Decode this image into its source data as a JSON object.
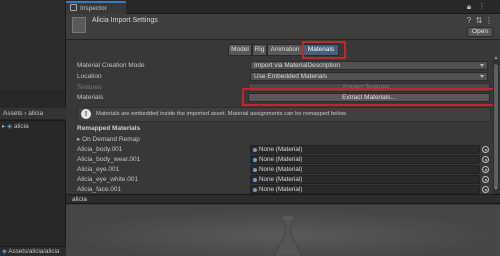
{
  "inspector": {
    "tab_label": "Inspector",
    "icons": [
      "lock-icon",
      "kebab-menu-icon"
    ],
    "asset_title": "Alicia Import Settings",
    "open_label": "Open"
  },
  "toolbar": {
    "tabs": [
      "Model",
      "Rig",
      "Animation",
      "Materials"
    ],
    "selected": "Materials",
    "selected_color": "#46607c",
    "highlight_color": "#c0262f"
  },
  "settings": {
    "material_creation_mode_label": "Material Creation Mode",
    "material_creation_mode_value": "Import via MaterialDescription",
    "location_label": "Location",
    "location_value": "Use Embedded Materials",
    "textures_label": "Textures",
    "textures_button": "Extract Textures...",
    "materials_label": "Materials",
    "materials_button": "Extract Materials..."
  },
  "info": {
    "icon": "exclamation-icon",
    "text": "Materials are embedded inside the imported asset. Material assignments can be remapped below."
  },
  "remapped": {
    "title": "Remapped Materials",
    "on_demand_label": "On Demand Remap",
    "rows": [
      {
        "name": "Alicia_body.001",
        "value": "None (Material)"
      },
      {
        "name": "Alicia_body_wear.001",
        "value": "None (Material)"
      },
      {
        "name": "Alicia_eye.001",
        "value": "None (Material)"
      },
      {
        "name": "Alicia_eye_white.001",
        "value": "None (Material)"
      },
      {
        "name": "Alicia_face.001",
        "value": "None (Material)"
      }
    ]
  },
  "preview": {
    "label": "alicia"
  },
  "project": {
    "breadcrumb": "Assets › alicia",
    "tree_item": "alicia",
    "footer_path": "Assets/alicia/alicia"
  }
}
